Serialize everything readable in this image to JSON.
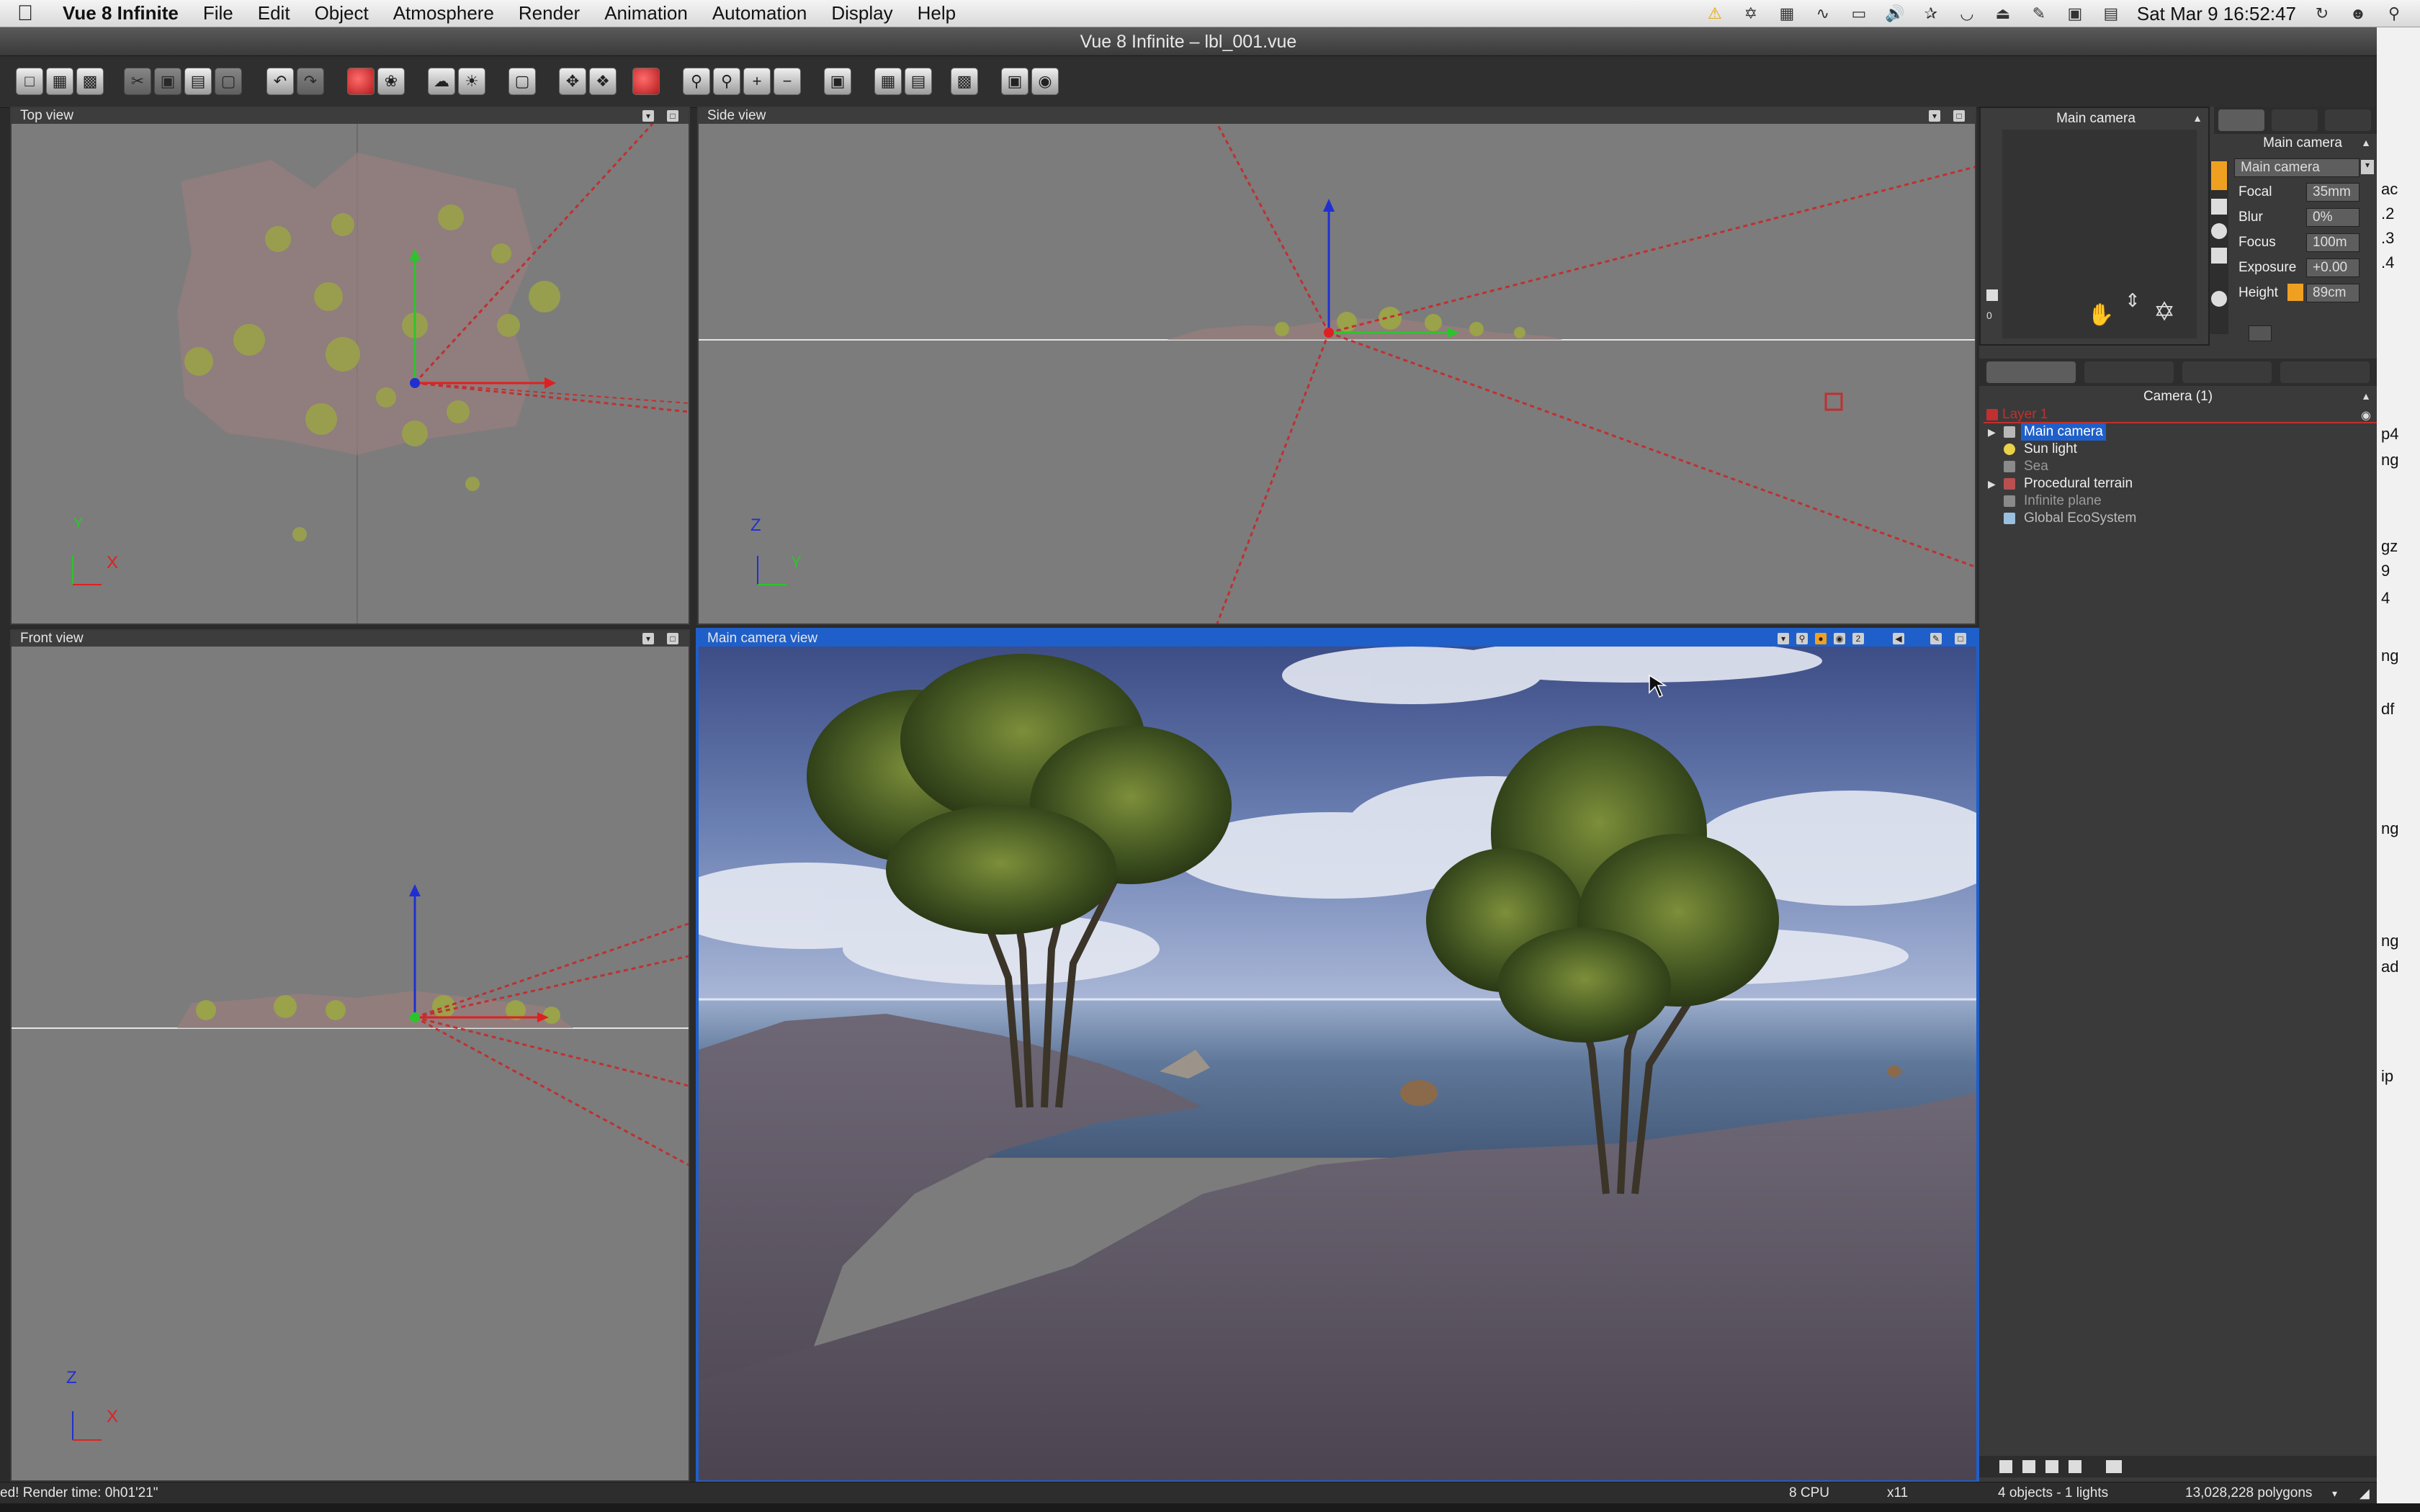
{
  "menubar": {
    "app_name": "Vue 8 Infinite",
    "items": [
      "File",
      "Edit",
      "Object",
      "Atmosphere",
      "Render",
      "Animation",
      "Automation",
      "Display",
      "Help"
    ],
    "clock": "Sat Mar 9  16:52:47"
  },
  "window": {
    "title": "Vue 8 Infinite – lbl_001.vue"
  },
  "viewports": {
    "top": {
      "label": "Top view",
      "axis_a": "Y",
      "axis_b": "X"
    },
    "side": {
      "label": "Side view",
      "axis_a": "Z",
      "axis_b": "Y"
    },
    "front": {
      "label": "Front view",
      "axis_a": "Z",
      "axis_b": "X"
    },
    "camera": {
      "label": "Main camera view"
    }
  },
  "camera_panel": {
    "preview_title": "Main camera",
    "title": "Main camera",
    "select_value": "Main camera",
    "fields": [
      {
        "label": "Focal",
        "value": "35mm"
      },
      {
        "label": "Blur",
        "value": "0%"
      },
      {
        "label": "Focus",
        "value": "100m"
      },
      {
        "label": "Exposure",
        "value": "+0.00"
      },
      {
        "label": "Height",
        "value": "89cm"
      }
    ]
  },
  "world_browser": {
    "title": "Camera (1)",
    "layer": "Layer 1",
    "items": [
      {
        "label": "Main camera",
        "selected": true,
        "expandable": true
      },
      {
        "label": "Sun light",
        "selected": false,
        "expandable": false
      },
      {
        "label": "Sea",
        "selected": false,
        "expandable": false
      },
      {
        "label": "Procedural terrain",
        "selected": false,
        "expandable": true
      },
      {
        "label": "Infinite plane",
        "selected": false,
        "expandable": false
      },
      {
        "label": "Global EcoSystem",
        "selected": false,
        "expandable": false
      }
    ]
  },
  "statusbar": {
    "render_time": "ed! Render time: 0h01'21\"",
    "cpu": "8 CPU",
    "mult": "x11",
    "objects": "4 objects - 1 lights",
    "polygons": "13,028,228 polygons"
  },
  "right_edge_fragments": [
    "ac",
    ".2",
    ".3",
    ".4",
    "p4",
    "ng",
    "gz",
    "9",
    "4",
    "ng",
    "df",
    "ng",
    "ng",
    "ad",
    "ip"
  ],
  "colors": {
    "selection_blue": "#1f5fc9",
    "viewport_gray": "#7c7c7c",
    "layer_red": "#c03030"
  }
}
